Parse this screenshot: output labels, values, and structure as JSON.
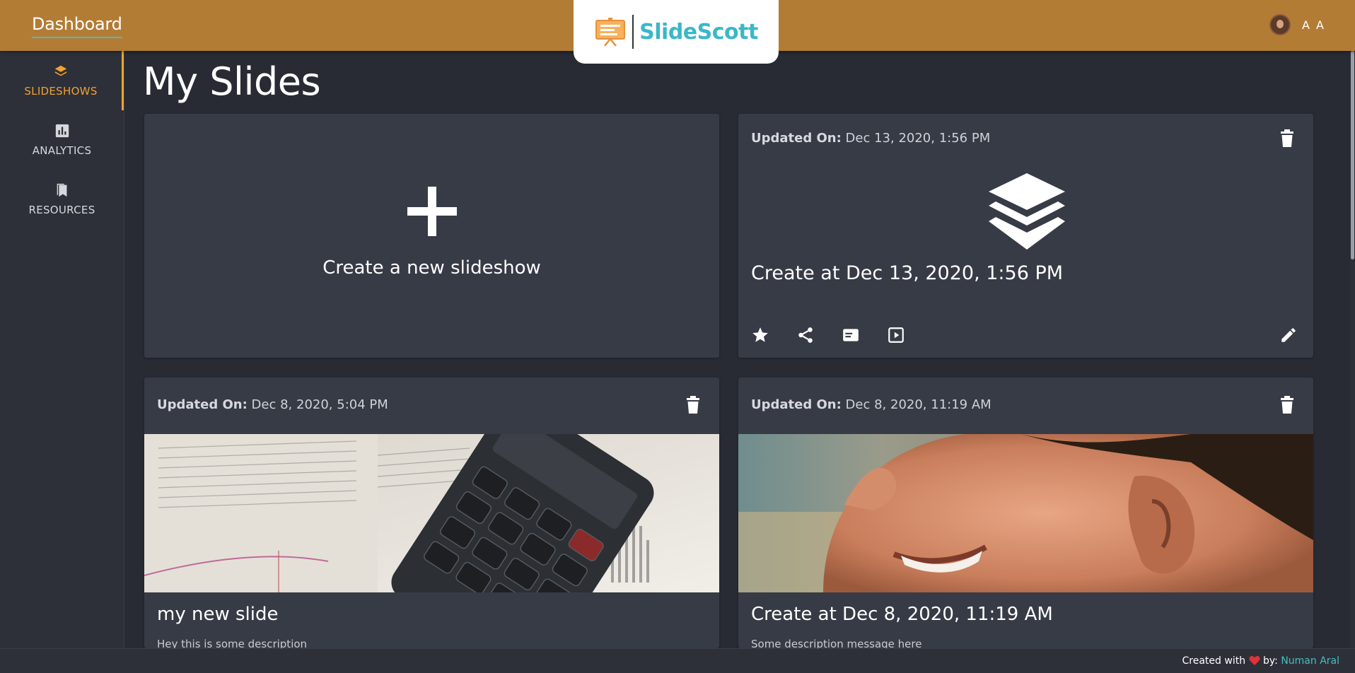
{
  "header": {
    "dashboard_label": "Dashboard",
    "brand": "SlideScott",
    "user_initials": "A A"
  },
  "sidebar": {
    "items": [
      {
        "label": "SLIDESHOWS",
        "icon": "layers-icon",
        "active": true
      },
      {
        "label": "ANALYTICS",
        "icon": "bar-chart-icon",
        "active": false
      },
      {
        "label": "RESOURCES",
        "icon": "bookmarks-icon",
        "active": false
      }
    ]
  },
  "main": {
    "title": "My Slides",
    "create_label": "Create a new slideshow",
    "cards": [
      {
        "updated_label": "Updated On:",
        "updated_value": "Dec 13, 2020, 1:56 PM",
        "title": "Create at Dec 13, 2020, 1:56 PM",
        "thumbnail": "layers-icon"
      },
      {
        "updated_label": "Updated On:",
        "updated_value": "Dec 8, 2020, 5:04 PM",
        "title": "my new slide",
        "description": "Hey this is some description",
        "thumbnail": "calculator-on-book-photo"
      },
      {
        "updated_label": "Updated On:",
        "updated_value": "Dec 8, 2020, 11:19 AM",
        "title": "Create at Dec 8, 2020, 11:19 AM",
        "description": "Some description message here",
        "thumbnail": "smiling-face-photo"
      }
    ]
  },
  "footer": {
    "created_with": "Created with",
    "by": "by:",
    "author": "Numan Aral"
  },
  "colors": {
    "header": "#b37c35",
    "accent": "#f0a132",
    "teal": "#45bfc4",
    "card": "#373b46",
    "background": "#282b33"
  }
}
